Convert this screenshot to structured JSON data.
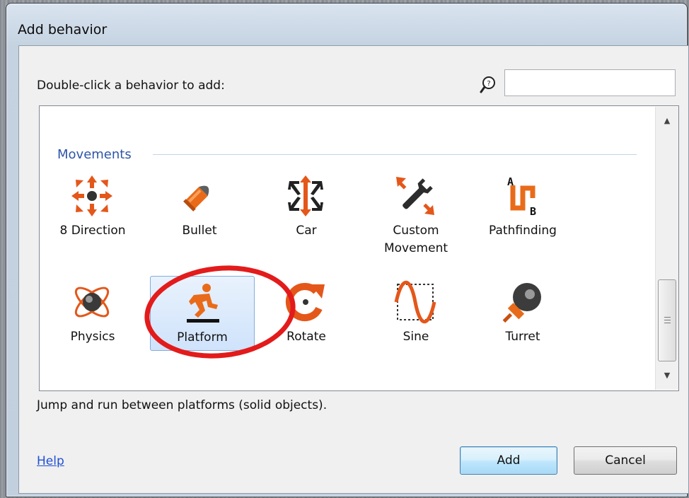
{
  "dialog": {
    "title": "Add behavior",
    "prompt": "Double-click a behavior to add:",
    "search": {
      "value": "",
      "placeholder": ""
    },
    "category": "Movements",
    "behaviors": [
      {
        "label": "8 Direction",
        "icon": "eight-direction-icon"
      },
      {
        "label": "Bullet",
        "icon": "bullet-icon"
      },
      {
        "label": "Car",
        "icon": "car-icon"
      },
      {
        "label": "Custom Movement",
        "icon": "custom-movement-icon"
      },
      {
        "label": "Pathfinding",
        "icon": "pathfinding-icon"
      },
      {
        "label": "Physics",
        "icon": "physics-icon"
      },
      {
        "label": "Platform",
        "icon": "platform-icon",
        "selected": true
      },
      {
        "label": "Rotate",
        "icon": "rotate-icon"
      },
      {
        "label": "Sine",
        "icon": "sine-icon"
      },
      {
        "label": "Turret",
        "icon": "turret-icon"
      }
    ],
    "description": "Jump and run between platforms (solid objects).",
    "help_label": "Help",
    "add_label": "Add",
    "cancel_label": "Cancel"
  },
  "colors": {
    "accent": "#e96b1a",
    "highlight_circle": "#e31b1b",
    "category_text": "#2e55a8",
    "link": "#1f4fd6"
  }
}
